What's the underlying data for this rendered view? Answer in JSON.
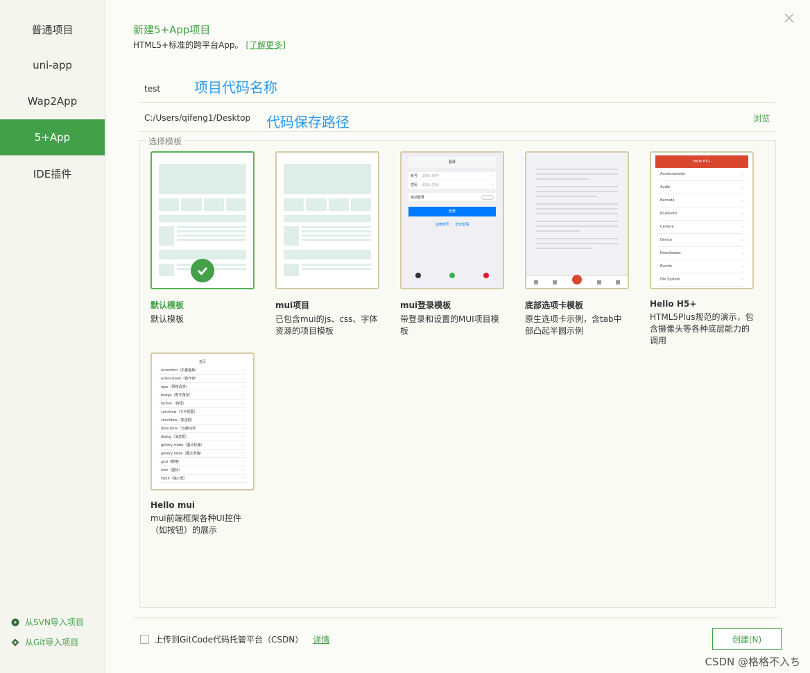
{
  "sidebar": {
    "items": [
      {
        "label": "普通项目"
      },
      {
        "label": "uni-app"
      },
      {
        "label": "Wap2App"
      },
      {
        "label": "5+App"
      },
      {
        "label": "IDE插件"
      }
    ],
    "import_svn": "从SVN导入项目",
    "import_git": "从Git导入项目"
  },
  "header": {
    "title": "新建5+App项目",
    "subtitle": "HTML5+标准的跨平台App。",
    "learn_more": "[了解更多]"
  },
  "form": {
    "project_name": "test",
    "project_name_annotation": "项目代码名称",
    "path": "C:/Users/qifeng1/Desktop",
    "path_annotation": "代码保存路径",
    "browse": "浏览"
  },
  "templates": {
    "legend": "选择模板",
    "items": [
      {
        "name": "默认模板",
        "desc": "默认模板"
      },
      {
        "name": "mui项目",
        "desc": "已包含mui的js、css、字体资源的项目模板"
      },
      {
        "name": "mui登录模板",
        "desc": "带登录和设置的MUI项目模板"
      },
      {
        "name": "底部选项卡模板",
        "desc": "原生选项卡示例，含tab中部凸起半圆示例"
      },
      {
        "name": "Hello H5+",
        "desc": "HTML5Plus规范的演示，包含摄像头等各种底层能力的调用"
      },
      {
        "name": "Hello mui",
        "desc": "mui前端框架各种UI控件（如按钮）的展示"
      }
    ],
    "login_preview": {
      "header": "登录",
      "account": "账号",
      "account_ph": "请输入账号",
      "password": "密码",
      "password_ph": "请输入密码",
      "auto_login": "自动登录",
      "button": "登录",
      "register": "注册账号",
      "forgot": "忘记密码"
    },
    "h5plus_preview": {
      "header": "Hello H5+",
      "rows": [
        "Accelerometer",
        "Audio",
        "Barcode",
        "Bluetooth",
        "Camera",
        "Device",
        "Downloader",
        "Events",
        "File System"
      ]
    },
    "mui_preview": {
      "header": "首页",
      "rows": [
        "accordion（折叠面板）",
        "actionsheet（操作表）",
        "ajax（网络请求）",
        "badge（数字角标）",
        "button（按钮）",
        "cardview（卡片视图）",
        "checkbox（复选框）",
        "date time（日期时间）",
        "dialog（消息框）",
        "gallery slider（图片轮播）",
        "gallery table（图文表格）",
        "grid（栅格）",
        "icon（图标）",
        "input（输入框）"
      ]
    }
  },
  "footer": {
    "upload_label": "上传到GitCode代码托管平台（CSDN）",
    "details": "详情",
    "create": "创建(N)",
    "watermark": "CSDN @格格不入ち"
  },
  "colors": {
    "accent": "#42a048",
    "annotation": "#2b9ae8",
    "card_border": "#d4cba6"
  }
}
